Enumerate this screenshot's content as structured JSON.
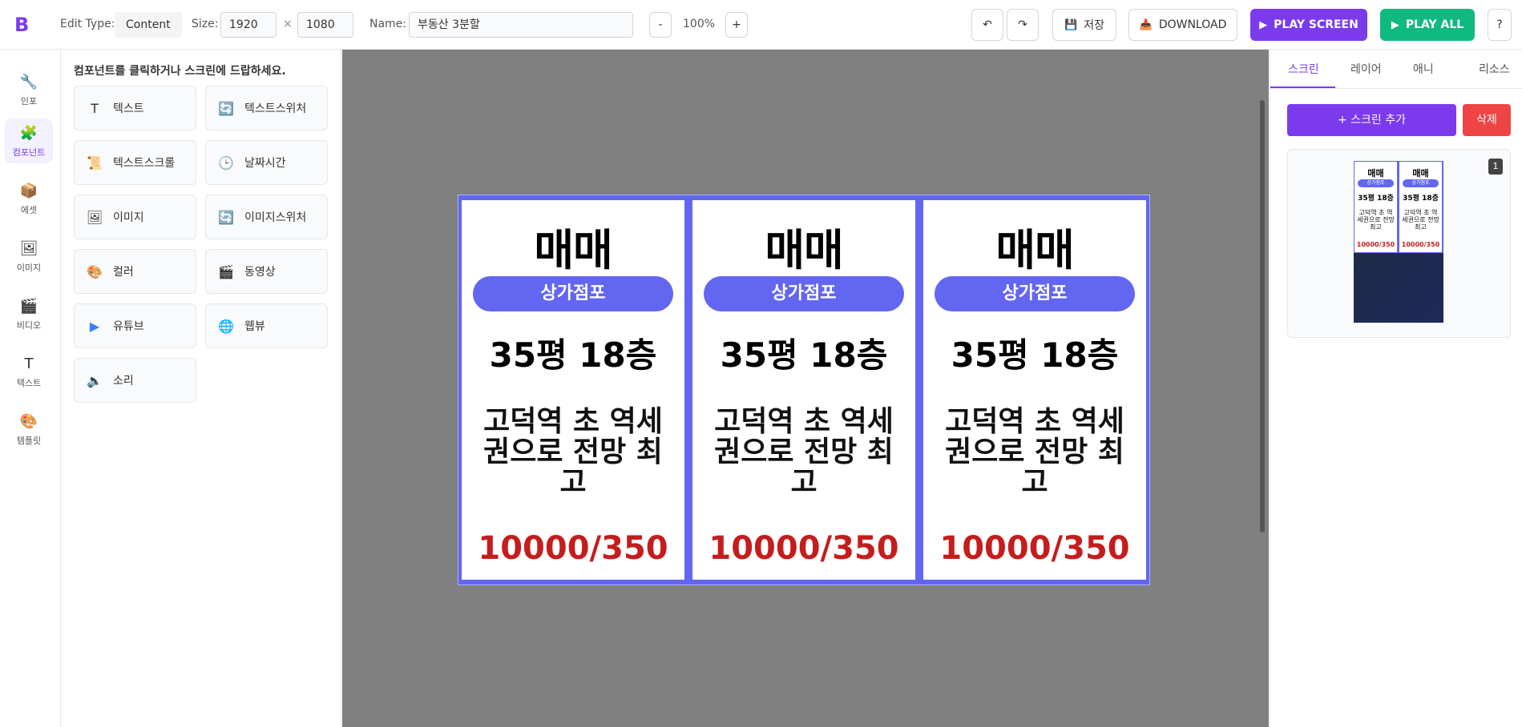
{
  "app": {
    "logo": "B"
  },
  "toolbar": {
    "edit_type_label": "Edit Type:",
    "edit_type_value": "Content",
    "size_label": "Size:",
    "width": "1920",
    "times": "×",
    "height": "1080",
    "name_label": "Name:",
    "name_value": "부동산 3분할",
    "zoom_minus": "-",
    "zoom": "100%",
    "zoom_plus": "+",
    "undo_icon": "↶",
    "redo_icon": "↷",
    "save_label": "저장",
    "download_label": "DOWNLOAD",
    "play_screen_label": "PLAY SCREEN",
    "play_all_label": "PLAY ALL",
    "help_label": "?"
  },
  "rail": [
    {
      "label": "인포",
      "icon": "🔧"
    },
    {
      "label": "컴포넌트",
      "icon": "🧩",
      "active": true
    },
    {
      "label": "에셋",
      "icon": "📦"
    },
    {
      "label": "이미지",
      "icon": "🖼"
    },
    {
      "label": "비디오",
      "icon": "🎬"
    },
    {
      "label": "텍스트",
      "icon": "T"
    },
    {
      "label": "템플릿",
      "icon": "🎨"
    }
  ],
  "palette": {
    "hint": "컴포넌트를 클릭하거나 스크린에 드랍하세요.",
    "items": [
      {
        "label": "텍스트",
        "icon": "T"
      },
      {
        "label": "텍스트스위처",
        "icon": "🔄"
      },
      {
        "label": "텍스트스크롤",
        "icon": "📜"
      },
      {
        "label": "날짜시간",
        "icon": "🕒"
      },
      {
        "label": "이미지",
        "icon": "🖼"
      },
      {
        "label": "이미지스위처",
        "icon": "🔄"
      },
      {
        "label": "컬러",
        "icon": "🎨"
      },
      {
        "label": "동영상",
        "icon": "🎬"
      },
      {
        "label": "유튜브",
        "icon": "▶"
      },
      {
        "label": "웹뷰",
        "icon": "🌐"
      },
      {
        "label": "소리",
        "icon": "🔈"
      }
    ]
  },
  "screen": {
    "columns": [
      {
        "title": "매매",
        "category": "상가점포",
        "size": "35평 18층",
        "desc": "고덕역 초 역세권으로 전망 최고",
        "price": "10000/350"
      },
      {
        "title": "매매",
        "category": "상가점포",
        "size": "35평 18층",
        "desc": "고덕역 초 역세권으로 전망 최고",
        "price": "10000/350"
      },
      {
        "title": "매매",
        "category": "상가점포",
        "size": "35평 18층",
        "desc": "고덕역 초 역세권으로 전망 최고",
        "price": "10000/350"
      }
    ],
    "colors": {
      "accent": "#6366f1",
      "price": "#c51d1d"
    }
  },
  "right_panel": {
    "tabs": [
      "스크린",
      "레이어",
      "애니",
      "리소스"
    ],
    "add_screen": "+ 스크린 추가",
    "delete": "삭제",
    "screen_badge": "1"
  }
}
